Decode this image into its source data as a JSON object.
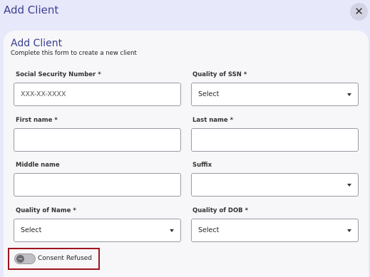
{
  "header": {
    "title": "Add Client",
    "close_icon": "close-icon"
  },
  "form": {
    "title": "Add Client",
    "subtitle": "Complete this form to create a new client",
    "ssn": {
      "label": "Social Security Number *",
      "placeholder": "XXX-XX-XXXX",
      "value": ""
    },
    "quality_ssn": {
      "label": "Quality of SSN *",
      "value": "Select"
    },
    "first_name": {
      "label": "First name *",
      "value": ""
    },
    "last_name": {
      "label": "Last name *",
      "value": ""
    },
    "middle_name": {
      "label": "Middle name",
      "value": ""
    },
    "suffix": {
      "label": "Suffix",
      "value": ""
    },
    "quality_name": {
      "label": "Quality of Name *",
      "value": "Select"
    },
    "quality_dob": {
      "label": "Quality of DOB *",
      "value": "Select"
    },
    "consent": {
      "label": "Consent Refused",
      "checked": false,
      "highlight_color": "#a0141e"
    }
  },
  "colors": {
    "accent": "#3a3f8f",
    "background": "#e8e8fb",
    "card": "#f7f7f9"
  }
}
